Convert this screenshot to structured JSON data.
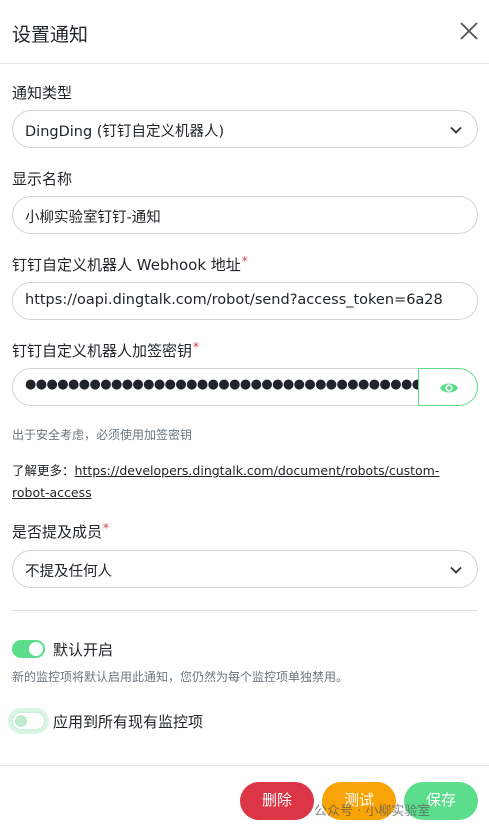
{
  "header": {
    "title": "设置通知"
  },
  "notify_type": {
    "label": "通知类型",
    "value": "DingDing (钉钉自定义机器人)"
  },
  "display_name": {
    "label": "显示名称",
    "value": "小柳实验室钉钉-通知"
  },
  "webhook": {
    "label": "钉钉自定义机器人 Webhook 地址",
    "required": "*",
    "value": "https://oapi.dingtalk.com/robot/send?access_token=6a28"
  },
  "secret": {
    "label": "钉钉自定义机器人加签密钥",
    "required": "*",
    "value": "●●●●●●●●●●●●●●●●●●●●●●●●●●●●●●●●●●●●●●●●●●●",
    "hint": "出于安全考虑，必须使用加签密钥"
  },
  "learn_more": {
    "prefix": "了解更多：",
    "link": "https://developers.dingtalk.com/document/robots/custom-robot-access"
  },
  "mention": {
    "label": "是否提及成员",
    "required": "*",
    "value": "不提及任何人"
  },
  "default_enabled": {
    "label": "默认开启",
    "hint": "新的监控项将默认启用此通知，您仍然为每个监控项单独禁用。"
  },
  "apply_all": {
    "label": "应用到所有现有监控项"
  },
  "buttons": {
    "delete": "删除",
    "test": "测试",
    "save": "保存"
  },
  "watermark": "公众号 · 小柳实验室",
  "colors": {
    "primary": "#5cdd8b",
    "danger": "#dc3545",
    "warning": "#f8a306"
  }
}
